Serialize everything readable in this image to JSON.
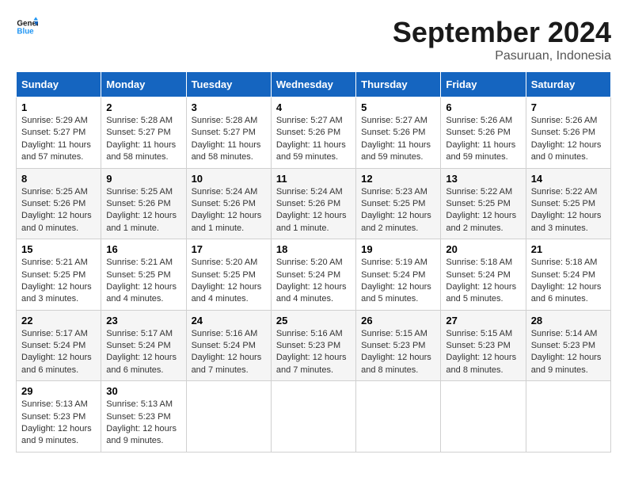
{
  "header": {
    "logo_line1": "General",
    "logo_line2": "Blue",
    "month_title": "September 2024",
    "location": "Pasuruan, Indonesia"
  },
  "weekdays": [
    "Sunday",
    "Monday",
    "Tuesday",
    "Wednesday",
    "Thursday",
    "Friday",
    "Saturday"
  ],
  "weeks": [
    [
      {
        "day": "1",
        "info": "Sunrise: 5:29 AM\nSunset: 5:27 PM\nDaylight: 11 hours and 57 minutes."
      },
      {
        "day": "2",
        "info": "Sunrise: 5:28 AM\nSunset: 5:27 PM\nDaylight: 11 hours and 58 minutes."
      },
      {
        "day": "3",
        "info": "Sunrise: 5:28 AM\nSunset: 5:27 PM\nDaylight: 11 hours and 58 minutes."
      },
      {
        "day": "4",
        "info": "Sunrise: 5:27 AM\nSunset: 5:26 PM\nDaylight: 11 hours and 59 minutes."
      },
      {
        "day": "5",
        "info": "Sunrise: 5:27 AM\nSunset: 5:26 PM\nDaylight: 11 hours and 59 minutes."
      },
      {
        "day": "6",
        "info": "Sunrise: 5:26 AM\nSunset: 5:26 PM\nDaylight: 11 hours and 59 minutes."
      },
      {
        "day": "7",
        "info": "Sunrise: 5:26 AM\nSunset: 5:26 PM\nDaylight: 12 hours and 0 minutes."
      }
    ],
    [
      {
        "day": "8",
        "info": "Sunrise: 5:25 AM\nSunset: 5:26 PM\nDaylight: 12 hours and 0 minutes."
      },
      {
        "day": "9",
        "info": "Sunrise: 5:25 AM\nSunset: 5:26 PM\nDaylight: 12 hours and 1 minute."
      },
      {
        "day": "10",
        "info": "Sunrise: 5:24 AM\nSunset: 5:26 PM\nDaylight: 12 hours and 1 minute."
      },
      {
        "day": "11",
        "info": "Sunrise: 5:24 AM\nSunset: 5:26 PM\nDaylight: 12 hours and 1 minute."
      },
      {
        "day": "12",
        "info": "Sunrise: 5:23 AM\nSunset: 5:25 PM\nDaylight: 12 hours and 2 minutes."
      },
      {
        "day": "13",
        "info": "Sunrise: 5:22 AM\nSunset: 5:25 PM\nDaylight: 12 hours and 2 minutes."
      },
      {
        "day": "14",
        "info": "Sunrise: 5:22 AM\nSunset: 5:25 PM\nDaylight: 12 hours and 3 minutes."
      }
    ],
    [
      {
        "day": "15",
        "info": "Sunrise: 5:21 AM\nSunset: 5:25 PM\nDaylight: 12 hours and 3 minutes."
      },
      {
        "day": "16",
        "info": "Sunrise: 5:21 AM\nSunset: 5:25 PM\nDaylight: 12 hours and 4 minutes."
      },
      {
        "day": "17",
        "info": "Sunrise: 5:20 AM\nSunset: 5:25 PM\nDaylight: 12 hours and 4 minutes."
      },
      {
        "day": "18",
        "info": "Sunrise: 5:20 AM\nSunset: 5:24 PM\nDaylight: 12 hours and 4 minutes."
      },
      {
        "day": "19",
        "info": "Sunrise: 5:19 AM\nSunset: 5:24 PM\nDaylight: 12 hours and 5 minutes."
      },
      {
        "day": "20",
        "info": "Sunrise: 5:18 AM\nSunset: 5:24 PM\nDaylight: 12 hours and 5 minutes."
      },
      {
        "day": "21",
        "info": "Sunrise: 5:18 AM\nSunset: 5:24 PM\nDaylight: 12 hours and 6 minutes."
      }
    ],
    [
      {
        "day": "22",
        "info": "Sunrise: 5:17 AM\nSunset: 5:24 PM\nDaylight: 12 hours and 6 minutes."
      },
      {
        "day": "23",
        "info": "Sunrise: 5:17 AM\nSunset: 5:24 PM\nDaylight: 12 hours and 6 minutes."
      },
      {
        "day": "24",
        "info": "Sunrise: 5:16 AM\nSunset: 5:24 PM\nDaylight: 12 hours and 7 minutes."
      },
      {
        "day": "25",
        "info": "Sunrise: 5:16 AM\nSunset: 5:23 PM\nDaylight: 12 hours and 7 minutes."
      },
      {
        "day": "26",
        "info": "Sunrise: 5:15 AM\nSunset: 5:23 PM\nDaylight: 12 hours and 8 minutes."
      },
      {
        "day": "27",
        "info": "Sunrise: 5:15 AM\nSunset: 5:23 PM\nDaylight: 12 hours and 8 minutes."
      },
      {
        "day": "28",
        "info": "Sunrise: 5:14 AM\nSunset: 5:23 PM\nDaylight: 12 hours and 9 minutes."
      }
    ],
    [
      {
        "day": "29",
        "info": "Sunrise: 5:13 AM\nSunset: 5:23 PM\nDaylight: 12 hours and 9 minutes."
      },
      {
        "day": "30",
        "info": "Sunrise: 5:13 AM\nSunset: 5:23 PM\nDaylight: 12 hours and 9 minutes."
      },
      null,
      null,
      null,
      null,
      null
    ]
  ]
}
